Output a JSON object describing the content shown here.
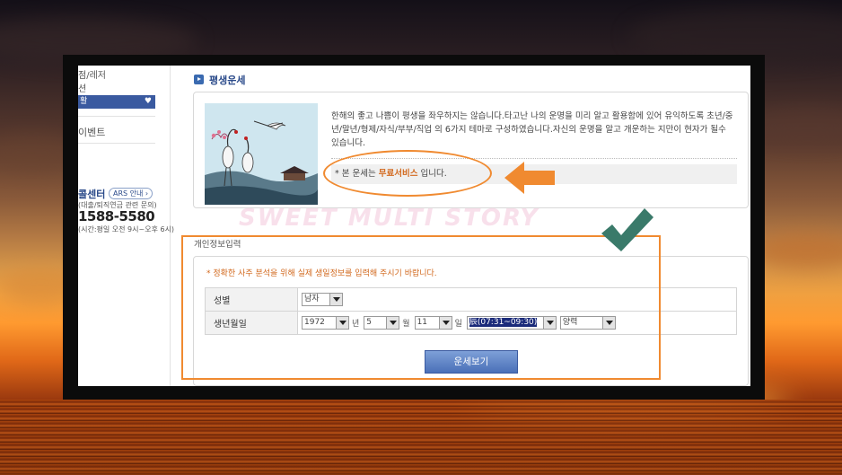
{
  "sidebar": {
    "top_item": "점/레저",
    "second_item": "션",
    "active_item": "활",
    "event_item": "이벤트",
    "call_center_title": "콜센터",
    "ars_badge": "ARS 안내",
    "call_sub": "(대출/퇴직연금 관련 문의)",
    "call_number": "1588-5580",
    "call_hours": "(시간:평일 오전 9시~오후 6시)"
  },
  "main": {
    "title": "평생운세",
    "intro_text": "한해의 좋고 나쁨이 평생을 좌우하지는 않습니다.타고난 나의 운명을 미리 알고 활용함에 있어 유익하도록 초년/중년/말년/형제/자식/부부/직업 의 6가지 테마로 구성하였습니다.자신의 운명을 알고 개운하는 지만이 현자가 될수 있습니다.",
    "free_prefix": "* 본 운세는",
    "free_highlight": "무료서비스",
    "free_suffix": "입니다.",
    "section_label": "개인정보입력",
    "notice": "* 정확한 사주 분석을 위해 실제 생일정보를 입력해 주시기 바랍니다.",
    "gender_label": "성별",
    "gender_value": "남자",
    "birth_label": "생년월일",
    "year_value": "1972",
    "year_unit": "년",
    "month_value": "5",
    "month_unit": "월",
    "day_value": "11",
    "day_unit": "일",
    "time_value": "辰(07:31~09:30)",
    "calendar_value": "양력",
    "submit_label": "운세보기"
  },
  "overlay": {
    "watermark": "SWEET MULTI STORY"
  },
  "colors": {
    "annotation": "#f08a30",
    "check": "#3a7a6a",
    "accent_blue": "#3a5aa0",
    "free_orange": "#d2691e"
  }
}
